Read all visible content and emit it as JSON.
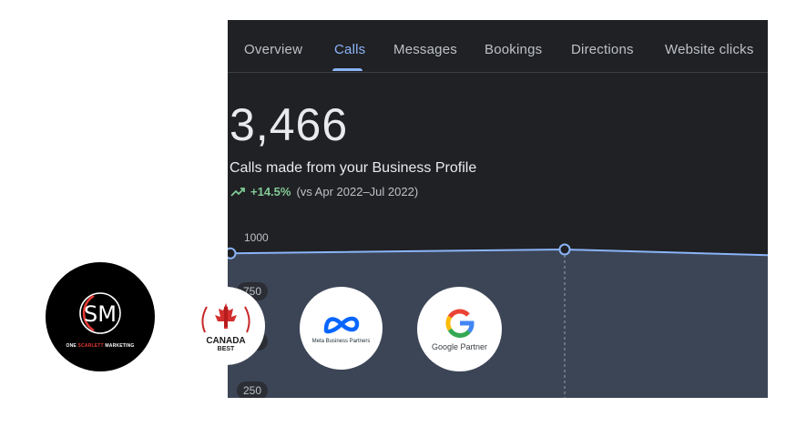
{
  "tabs": [
    {
      "label": "Overview",
      "active": false
    },
    {
      "label": "Calls",
      "active": true
    },
    {
      "label": "Messages",
      "active": false
    },
    {
      "label": "Bookings",
      "active": false
    },
    {
      "label": "Directions",
      "active": false
    },
    {
      "label": "Website clicks",
      "active": false
    }
  ],
  "metric": {
    "value": "3,466",
    "caption": "Calls made from your Business Profile",
    "change": "+14.5%",
    "comparison": "(vs Apr 2022–Jul 2022)",
    "trend_icon": "trending-up-icon"
  },
  "chart_data": {
    "type": "area",
    "y_ticks": [
      "1000",
      "750",
      "500",
      "250"
    ],
    "series": [
      {
        "values": [
          980,
          1000,
          970
        ]
      }
    ],
    "line_color": "#8ab4f8",
    "fill_color": "#3c4556"
  },
  "logos": {
    "scarlett": {
      "monogram": "SM",
      "name_prefix": "ONE ",
      "name_red": "SCARLETT",
      "name_suffix": " MARKETING"
    },
    "canada": {
      "line1": "CANADA",
      "line2": "BEST"
    },
    "meta": {
      "label": "Meta Business Partners"
    },
    "google": {
      "label": "Google Partner"
    }
  },
  "colors": {
    "panel_bg": "#202124",
    "accent": "#8ab4f8",
    "positive": "#81c995",
    "brand_red": "#e53935"
  }
}
